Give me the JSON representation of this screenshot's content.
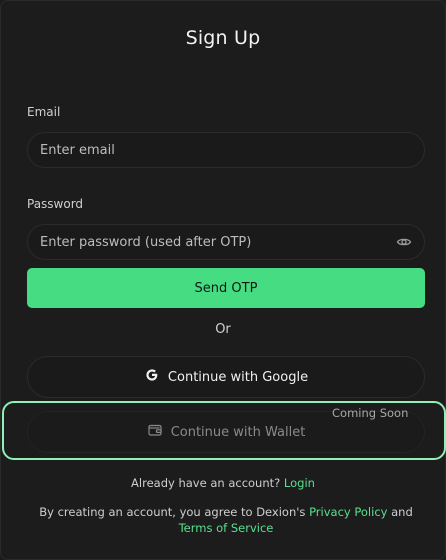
{
  "title": "Sign Up",
  "email": {
    "label": "Email",
    "placeholder": "Enter email"
  },
  "password": {
    "label": "Password",
    "placeholder": "Enter password (used after OTP)"
  },
  "send_otp": "Send OTP",
  "divider": "Or",
  "google": {
    "label": "Continue with Google",
    "icon": "google-g-icon"
  },
  "wallet": {
    "label": "Continue with Wallet",
    "icon": "wallet-icon",
    "badge": "Coming Soon"
  },
  "account": {
    "prompt": "Already have an account?",
    "link": "Login"
  },
  "terms": {
    "prefix": "By creating an account, you agree to Dexion's",
    "privacy": "Privacy Policy",
    "and": "and",
    "terms_link": "Terms of Service"
  },
  "colors": {
    "accent": "#46dc82",
    "background": "#1c1c1c",
    "highlight_border": "#8ff2b4"
  }
}
